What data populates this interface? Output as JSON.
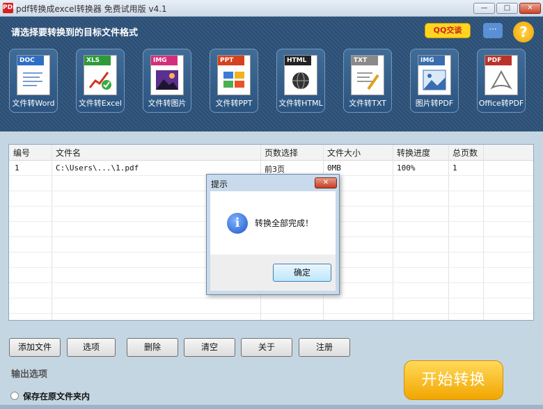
{
  "window": {
    "app_icon": "PDF",
    "title": "pdf转换成excel转换器 免费试用版 v4.1",
    "min_glyph": "—",
    "max_glyph": "□",
    "close_glyph": "✕"
  },
  "banner": {
    "title": "请选择要转换到的目标文件格式",
    "qq_label": "QQ交谈",
    "chat_glyph": "···",
    "help_glyph": "?"
  },
  "tiles": [
    {
      "tag": "DOC",
      "label": "文件转Word",
      "color": "#2e6fc4"
    },
    {
      "tag": "XLS",
      "label": "文件转Excel",
      "color": "#2e9a3a"
    },
    {
      "tag": "IMG",
      "label": "文件转图片",
      "color": "#d2307c"
    },
    {
      "tag": "PPT",
      "label": "文件转PPT",
      "color": "#d5421f"
    },
    {
      "tag": "HTML",
      "label": "文件转HTML",
      "color": "#222222"
    },
    {
      "tag": "TXT",
      "label": "文件转TXT",
      "color": "#8a8a8a"
    },
    {
      "tag": "IMG",
      "label": "图片转PDF",
      "color": "#3a6db0"
    },
    {
      "tag": "PDF",
      "label": "Office转PDF",
      "color": "#b8342a"
    }
  ],
  "table": {
    "headers": [
      "编号",
      "文件名",
      "页数选择",
      "文件大小",
      "转换进度",
      "总页数"
    ],
    "rows": [
      [
        "1",
        "C:\\Users\\...\\1.pdf",
        "前3页",
        "0MB",
        "100%",
        "1"
      ]
    ]
  },
  "dialog": {
    "title": "提示",
    "close_glyph": "✕",
    "message": "转换全部完成！",
    "ok_label": "确定"
  },
  "buttons": {
    "add_file": "添加文件",
    "options": "选项",
    "delete": "删除",
    "clear": "清空",
    "about": "关于",
    "register": "注册"
  },
  "output": {
    "section_label": "输出选项",
    "radio_label": "保存在原文件夹内"
  },
  "start_button": "开始转换"
}
